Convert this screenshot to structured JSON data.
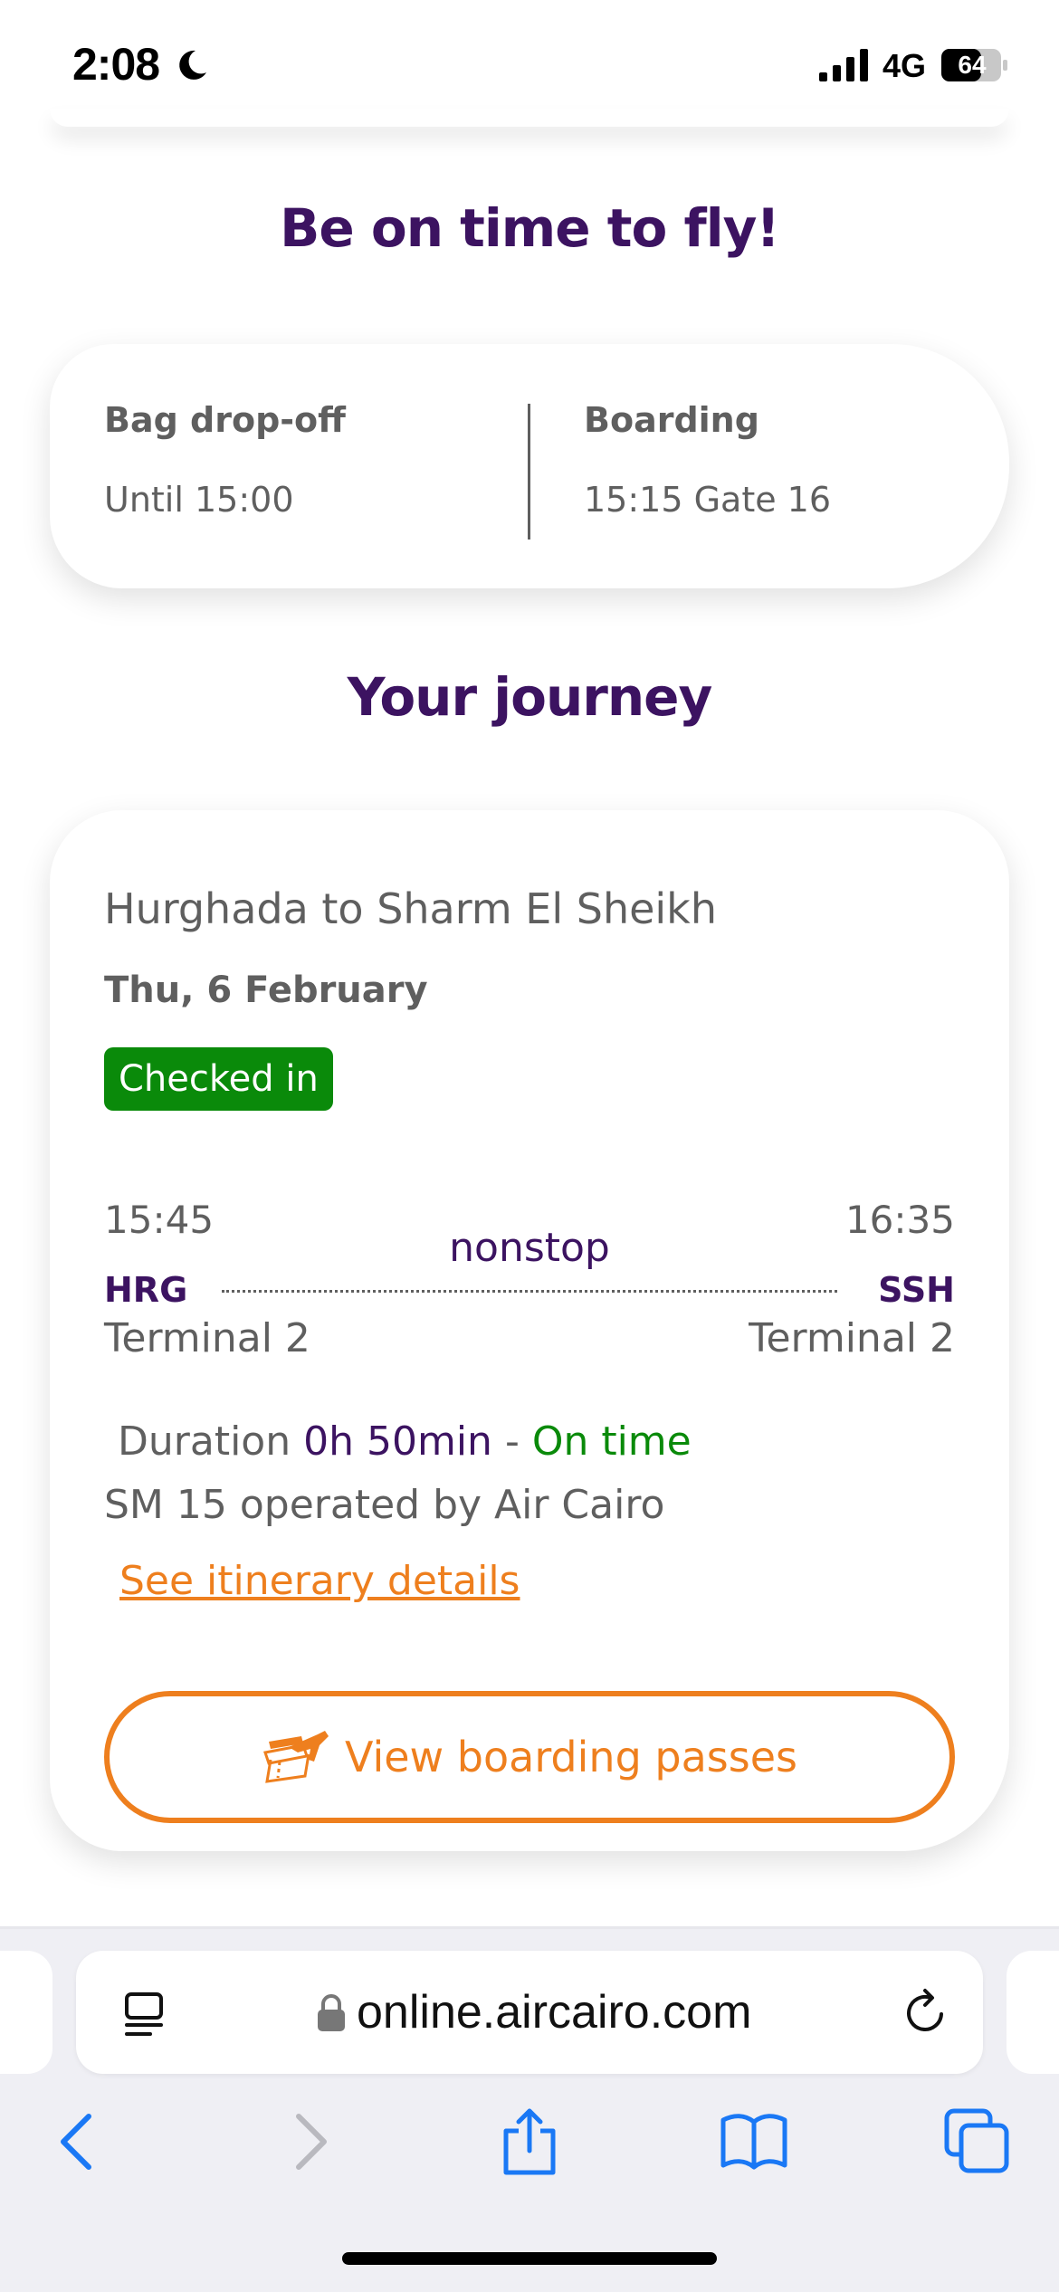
{
  "status": {
    "time": "2:08",
    "network": "4G",
    "battery": "64"
  },
  "headline": "Be on time to fly!",
  "times_card": {
    "bag_label": "Bag drop-off",
    "bag_value": "Until 15:00",
    "boarding_label": "Boarding",
    "boarding_value": "15:15  Gate 16"
  },
  "journey_title": "Your journey",
  "journey": {
    "route": "Hurghada to Sharm El Sheikh",
    "date": "Thu, 6 February",
    "status_badge": "Checked in",
    "depart_time": "15:45",
    "arrive_time": "16:35",
    "stops": "nonstop",
    "origin_code": "HRG",
    "dest_code": "SSH",
    "origin_terminal": "Terminal 2",
    "dest_terminal": "Terminal 2",
    "duration_label": "Duration",
    "duration_value": "0h 50min",
    "separator": "-",
    "on_time": "On time",
    "operated": "SM 15 operated by Air Cairo",
    "itinerary_link": "See itinerary details",
    "boarding_button": "View boarding passes"
  },
  "browser": {
    "url": "online.aircairo.com"
  },
  "colors": {
    "purple": "#3c1361",
    "orange": "#ee7f1e",
    "green": "#0a8a0a"
  }
}
